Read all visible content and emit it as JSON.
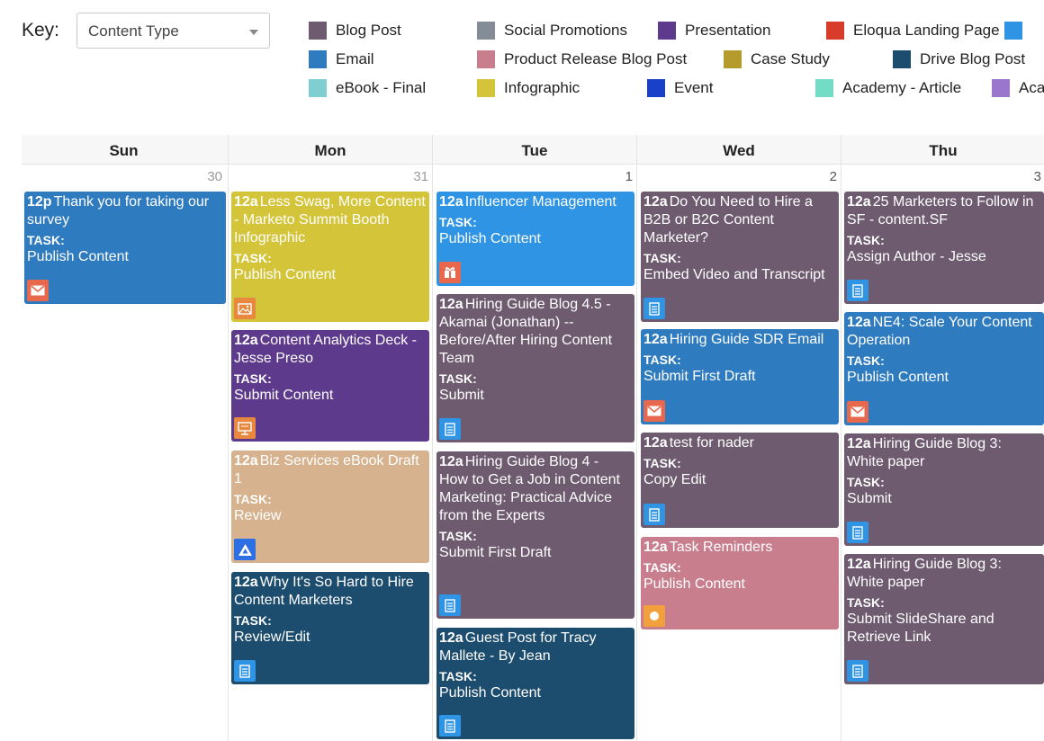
{
  "key": {
    "label": "Key:",
    "select_value": "Content Type"
  },
  "legend": [
    {
      "label": "Blog Post",
      "color": "#6e5b70"
    },
    {
      "label": "Social Promotions",
      "color": "#848d96"
    },
    {
      "label": "Presentation",
      "color": "#5e3a8c"
    },
    {
      "label": "Eloqua Landing Page",
      "color": "#d93b2b"
    },
    {
      "label": "",
      "color": "#2e94e3"
    },
    {
      "label": "Email",
      "color": "#2f7bbf"
    },
    {
      "label": "Product Release Blog Post",
      "color": "#c97e8e"
    },
    {
      "label": "Case Study",
      "color": "#b59a2c"
    },
    {
      "label": "Drive Blog Post",
      "color": "#1d4d6e"
    },
    {
      "label": "eBook - Final",
      "color": "#7fcfd2"
    },
    {
      "label": "Infographic",
      "color": "#d4c43a"
    },
    {
      "label": "Event",
      "color": "#1840c8"
    },
    {
      "label": "Academy - Article",
      "color": "#72dcc4"
    },
    {
      "label": "Aca",
      "color": "#9a76cc"
    }
  ],
  "columns": [
    {
      "name": "Sun",
      "day": "30"
    },
    {
      "name": "Mon",
      "day": "31"
    },
    {
      "name": "Tue",
      "day": "1"
    },
    {
      "name": "Wed",
      "day": "2"
    },
    {
      "name": "Thu",
      "day": "3"
    }
  ],
  "events": {
    "sun": [
      {
        "time": "12p",
        "title": "Thank you for taking our survey",
        "task_label": "TASK:",
        "task": "Publish Content",
        "color": "#2f7bbf",
        "icon": "email-icon"
      }
    ],
    "mon": [
      {
        "time": "12a",
        "title": "Less Swag, More Content - Marketo Summit Booth Infographic",
        "task_label": "TASK:",
        "task": "Publish Content",
        "color": "#d4c43a",
        "icon": "image-icon"
      },
      {
        "time": "12a",
        "title": "Content Analytics Deck - Jesse Preso",
        "task_label": "TASK:",
        "task": "Submit Content",
        "color": "#5e3a8c",
        "icon": "presentation-icon"
      },
      {
        "time": "12a",
        "title": "Biz Services eBook Draft 1",
        "task_label": "TASK:",
        "task": "Review",
        "color": "#d6b28f",
        "icon": "drive-icon"
      },
      {
        "time": "12a",
        "title": "Why It's So Hard to Hire Content Marketers",
        "task_label": "TASK:",
        "task": "Review/Edit",
        "color": "#1d4d6e",
        "icon": "document-icon"
      }
    ],
    "tue": [
      {
        "time": "12a",
        "title": "Influencer Management",
        "task_label": "TASK:",
        "task": "Publish Content",
        "color": "#2e94e3",
        "icon": "influencer-icon"
      },
      {
        "time": "12a",
        "title": "Hiring Guide Blog 4.5 - Akamai (Jonathan) -- Before/After Hiring Content Team",
        "task_label": "TASK:",
        "task": "Submit",
        "color": "#6e5b70",
        "icon": "document-icon"
      },
      {
        "time": "12a",
        "title": "Hiring Guide Blog 4 - How to Get a Job in Content Marketing: Practical Advice from the Experts",
        "task_label": "TASK:",
        "task": "Submit First Draft",
        "color": "#6e5b70",
        "icon": "document-icon"
      },
      {
        "time": "12a",
        "title": "Guest Post for Tracy Mallete - By Jean",
        "task_label": "TASK:",
        "task": "Publish Content",
        "color": "#1d4d6e",
        "icon": "document-icon"
      }
    ],
    "wed": [
      {
        "time": "12a",
        "title": "Do You Need to Hire a B2B or B2C Content Marketer?",
        "task_label": "TASK:",
        "task": "Embed Video and Transcript",
        "color": "#6e5b70",
        "icon": "document-icon"
      },
      {
        "time": "12a",
        "title": "Hiring Guide SDR Email",
        "task_label": "TASK:",
        "task": "Submit First Draft",
        "color": "#2f7bbf",
        "icon": "email-icon"
      },
      {
        "time": "12a",
        "title": "test for nader",
        "task_label": "TASK:",
        "task": "Copy Edit",
        "color": "#6e5b70",
        "icon": "document-icon"
      },
      {
        "time": "12a",
        "title": "Task Reminders",
        "task_label": "TASK:",
        "task": "Publish Content",
        "color": "#c97e8e",
        "icon": "circle-icon"
      }
    ],
    "thu": [
      {
        "time": "12a",
        "title": "25 Marketers to Follow in SF - content.SF",
        "task_label": "TASK:",
        "task": "Assign Author - Jesse",
        "color": "#6e5b70",
        "icon": "document-icon"
      },
      {
        "time": "12a",
        "title": "NE4: Scale Your Content Operation",
        "task_label": "TASK:",
        "task": "Publish Content",
        "color": "#2f7bbf",
        "icon": "email-icon"
      },
      {
        "time": "12a",
        "title": "Hiring Guide Blog 3: White paper",
        "task_label": "TASK:",
        "task": "Submit",
        "color": "#6e5b70",
        "icon": "document-icon"
      },
      {
        "time": "12a",
        "title": "Hiring Guide Blog 3: White paper",
        "task_label": "TASK:",
        "task": "Submit SlideShare and Retrieve Link",
        "color": "#6e5b70",
        "icon": "document-icon"
      }
    ]
  },
  "icon_colors": {
    "email": "#e8684e",
    "document": "#2e94e3",
    "image": "#e8873e",
    "presentation": "#e8873e",
    "drive": "#2e6fe3",
    "influencer": "#e8684e",
    "circle": "#f2a03c"
  }
}
